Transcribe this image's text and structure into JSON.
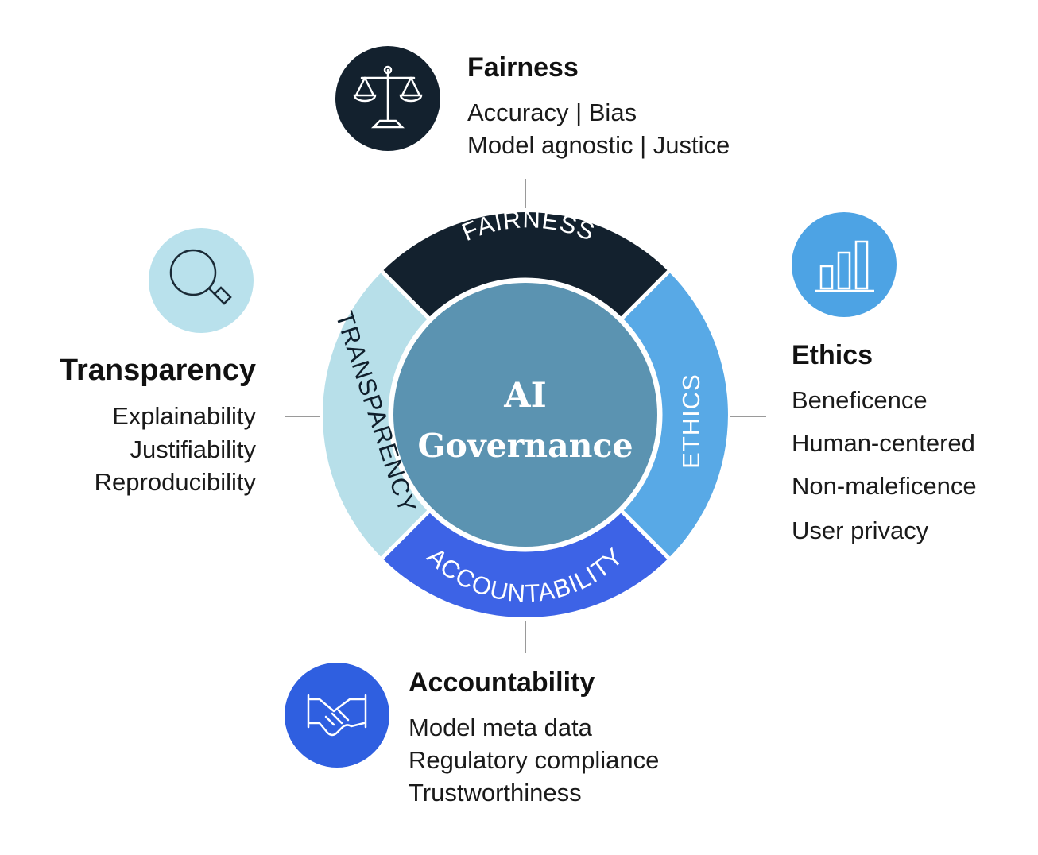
{
  "center": {
    "line1": "AI",
    "line2": "Governance"
  },
  "ring": {
    "top": "FAIRNESS",
    "right": "ETHICS",
    "bottom": "ACCOUNTABILITY",
    "left": "TRANSPARENCY"
  },
  "pillars": {
    "fairness": {
      "title": "Fairness",
      "items": [
        "Accuracy | Bias",
        "Model agnostic | Justice"
      ],
      "icon": "scales-icon",
      "color": "#13212e"
    },
    "ethics": {
      "title": "Ethics",
      "items": [
        "Beneficence",
        "Human-centered",
        "Non-maleficence",
        "User privacy"
      ],
      "icon": "bar-chart-icon",
      "color": "#4da3e4"
    },
    "transparency": {
      "title": "Transparency",
      "items": [
        "Explainability",
        "Justifiability",
        "Reproducibility"
      ],
      "icon": "magnifier-icon",
      "color": "#b9e1ec"
    },
    "accountability": {
      "title": "Accountability",
      "items": [
        "Model meta data",
        "Regulatory compliance",
        "Trustworthiness"
      ],
      "icon": "handshake-icon",
      "color": "#2f5fe0"
    }
  },
  "colors": {
    "fairness_segment": "#13212e",
    "ethics_segment": "#58a9e6",
    "accountability_segment": "#3d63e6",
    "transparency_segment": "#b7dfe9",
    "center": "#5b93b1"
  }
}
